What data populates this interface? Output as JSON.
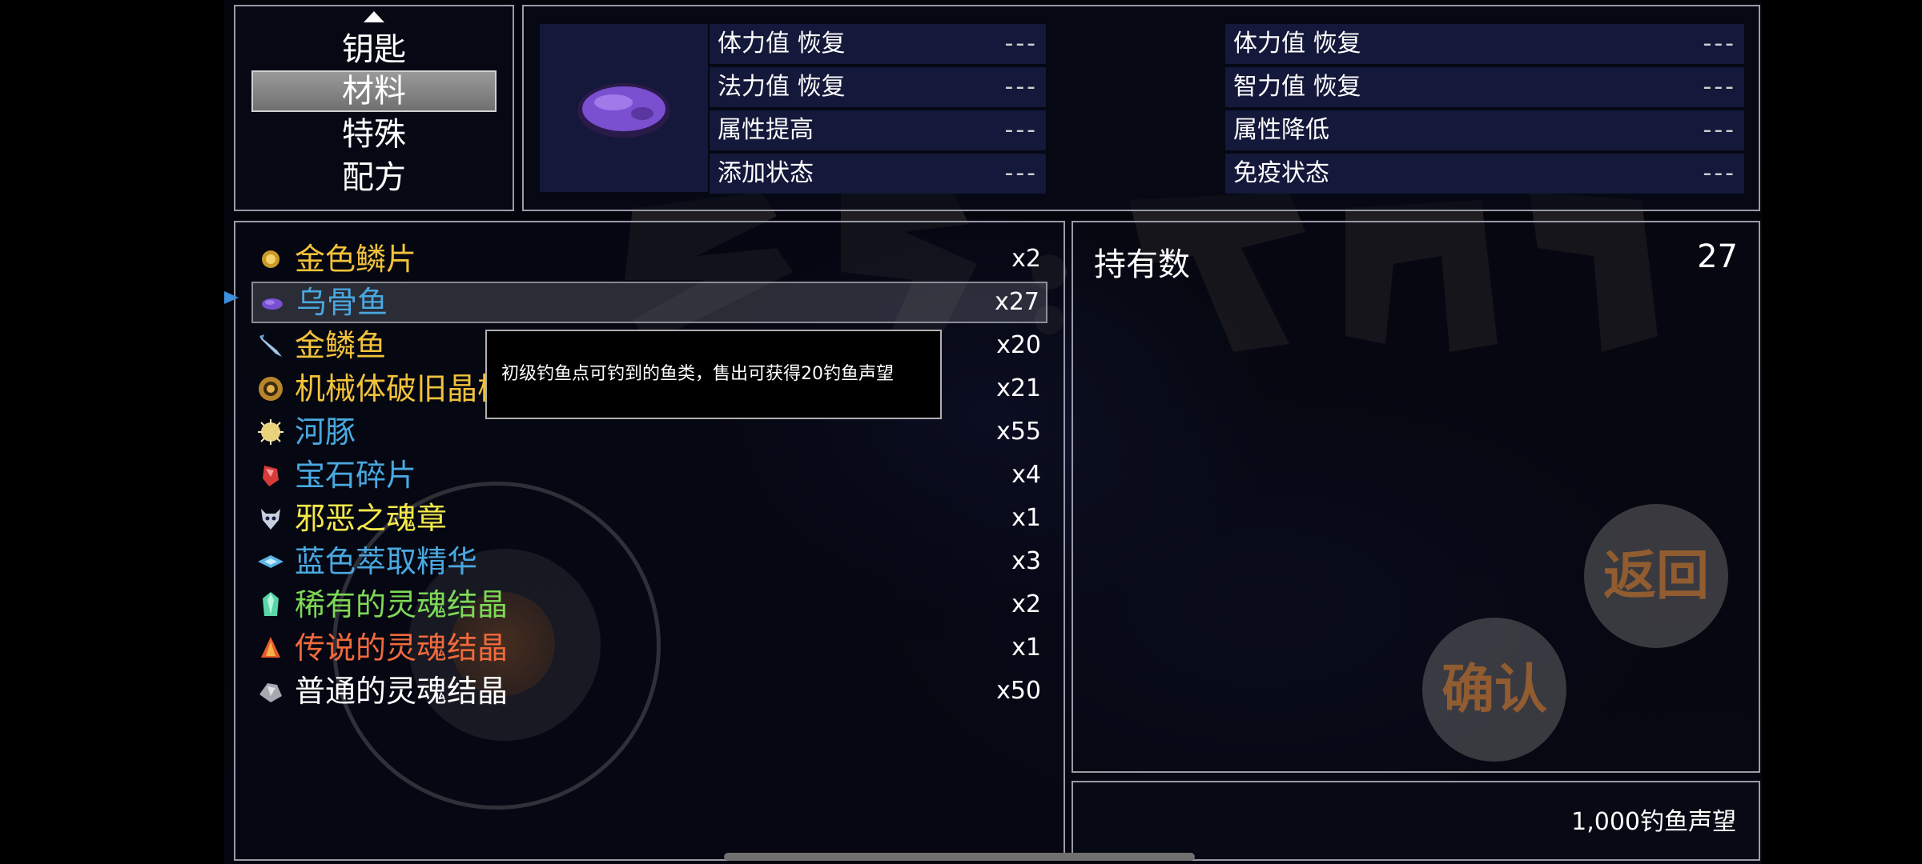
{
  "categories": {
    "items": [
      {
        "label": "钥匙"
      },
      {
        "label": "材料"
      },
      {
        "label": "特殊"
      },
      {
        "label": "配方"
      }
    ],
    "selected": "材料"
  },
  "detail": {
    "stats": [
      {
        "label": "体力值 恢复",
        "value": "---"
      },
      {
        "label": "体力值 恢复",
        "value": "---"
      },
      {
        "label": "法力值 恢复",
        "value": "---"
      },
      {
        "label": "智力值 恢复",
        "value": "---"
      },
      {
        "label": "属性提高",
        "value": "---"
      },
      {
        "label": "属性降低",
        "value": "---"
      },
      {
        "label": "添加状态",
        "value": "---"
      },
      {
        "label": "免疫状态",
        "value": "---"
      }
    ]
  },
  "items": [
    {
      "name": "金色鳞片",
      "count": "x2",
      "color": "#f2c23a",
      "icon": "gold-scale-icon"
    },
    {
      "name": "乌骨鱼",
      "count": "x27",
      "color": "#4aa8e0",
      "icon": "purple-fish-icon"
    },
    {
      "name": "金鳞鱼",
      "count": "x20",
      "color": "#f2c23a",
      "icon": "fish-icon"
    },
    {
      "name": "机械体破旧晶核",
      "count": "x21",
      "color": "#f2c23a",
      "icon": "gear-core-icon"
    },
    {
      "name": "河豚",
      "count": "x55",
      "color": "#4aa8e0",
      "icon": "pufferfish-icon"
    },
    {
      "name": "宝石碎片",
      "count": "x4",
      "color": "#4aa8e0",
      "icon": "gem-shard-icon"
    },
    {
      "name": "邪恶之魂章",
      "count": "x1",
      "color": "#f5e84a",
      "icon": "demon-emblem-icon"
    },
    {
      "name": "蓝色萃取精华",
      "count": "x3",
      "color": "#4aa8e0",
      "icon": "blue-essence-icon"
    },
    {
      "name": "稀有的灵魂结晶",
      "count": "x2",
      "color": "#7ed957",
      "icon": "green-crystal-icon"
    },
    {
      "name": "传说的灵魂结晶",
      "count": "x1",
      "color": "#f06a3c",
      "icon": "orange-crystal-icon"
    },
    {
      "name": "普通的灵魂结晶",
      "count": "x50",
      "color": "#ffffff",
      "icon": "gray-crystal-icon"
    }
  ],
  "selected_item": "乌骨鱼",
  "tooltip": {
    "text": "初级钓鱼点可钓到的鱼类，售出可获得20钓鱼声望"
  },
  "holdings": {
    "label": "持有数",
    "value": "27"
  },
  "price": {
    "text": "1,000钓鱼声望"
  },
  "buttons": {
    "back": "返回",
    "confirm": "确认"
  },
  "colors": {
    "window_border": "#9a9aa8",
    "stat_bg": "#14183a",
    "cursor": "#3d8fe0"
  }
}
